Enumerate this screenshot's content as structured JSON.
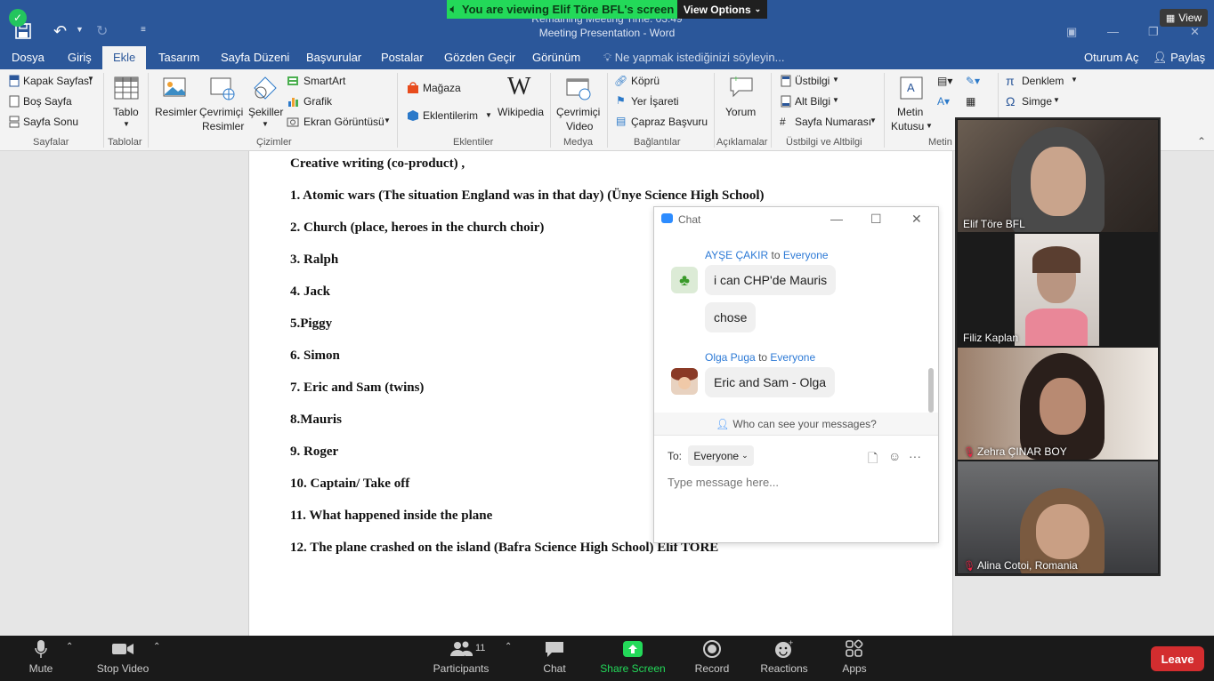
{
  "zoom": {
    "share_banner": "You are viewing Elif Töre BFL's screen",
    "view_options": "View Options",
    "view_button": "View"
  },
  "word": {
    "title_time": "Remaining Meeting Time: 03:49",
    "title": "Meeting Presentation - Word",
    "tabs": [
      "Dosya",
      "Giriş",
      "Ekle",
      "Tasarım",
      "Sayfa Düzeni",
      "Başvurular",
      "Postalar",
      "Gözden Geçir",
      "Görünüm"
    ],
    "active_tab": "Ekle",
    "tell_me": "Ne yapmak istediğinizi söyleyin...",
    "sign_in": "Oturum Aç",
    "share": "Paylaş"
  },
  "ribbon": {
    "sayfalar": {
      "items": [
        "Kapak Sayfası",
        "Boş Sayfa",
        "Sayfa Sonu"
      ],
      "caption": "Sayfalar"
    },
    "tablolar": {
      "tablo": "Tablo",
      "caption": "Tablolar"
    },
    "cizimler": {
      "resimler": "Resimler",
      "cevrimici_1": "Çevrimiçi",
      "cevrimici_2": "Resimler",
      "sekiller": "Şekiller",
      "smartart": "SmartArt",
      "grafik": "Grafik",
      "ekran": "Ekran Görüntüsü",
      "caption": "Çizimler"
    },
    "eklentiler": {
      "magaza": "Mağaza",
      "eklentilerim": "Eklentilerim",
      "wikipedia": "Wikipedia",
      "caption": "Eklentiler"
    },
    "medya": {
      "video_1": "Çevrimiçi",
      "video_2": "Video",
      "caption": "Medya"
    },
    "baglantilar": {
      "kopru": "Köprü",
      "yer_isareti": "Yer İşareti",
      "capraz": "Çapraz Başvuru",
      "caption": "Bağlantılar"
    },
    "aciklamalar": {
      "yorum": "Yorum",
      "caption": "Açıklamalar"
    },
    "ustbilgi": {
      "ustbilgi": "Üstbilgi",
      "altbilgi": "Alt Bilgi",
      "sayfa_no": "Sayfa Numarası",
      "caption": "Üstbilgi ve Altbilgi"
    },
    "metin": {
      "kutu_1": "Metin",
      "kutu_2": "Kutusu",
      "caption": "Metin"
    },
    "simgeler": {
      "denklem": "Denklem",
      "simge": "Simge"
    }
  },
  "document": {
    "lines": [
      "Creative writing (co-product) ,",
      "1. Atomic wars (The situation England was in that day) (Ünye Science High School)",
      "2. Church (place, heroes in the church choir)",
      "3. Ralph",
      "4. Jack",
      "5.Piggy",
      "6. Simon",
      "7. Eric and Sam (twins)",
      "8.Mauris",
      "9. Roger",
      "10. Captain/ Take off",
      "11. What happened inside the plane",
      "12. The plane crashed on the island (Bafra Science High School) Elif TORE"
    ]
  },
  "chat": {
    "title": "Chat",
    "messages": [
      {
        "sender": "AYŞE ÇAKIR",
        "to_word": "to",
        "to": "Everyone",
        "bubbles": [
          "i can CHP'de Mauris",
          "chose"
        ]
      },
      {
        "sender": "Olga Puga",
        "to_word": "to",
        "to": "Everyone",
        "bubbles": [
          "Eric and Sam  - Olga"
        ]
      }
    ],
    "who_can_see": "Who can see your messages?",
    "to_label": "To:",
    "to_value": "Everyone",
    "placeholder": "Type message here..."
  },
  "videos": [
    {
      "name": "Elif Töre BFL",
      "muted": false
    },
    {
      "name": "Filiz Kaplan",
      "muted": false
    },
    {
      "name": "Zehra ÇINAR BOY",
      "muted": true
    },
    {
      "name": "Alina Cotoi, Romania",
      "muted": true
    }
  ],
  "toolbar": {
    "mute": "Mute",
    "stop_video": "Stop Video",
    "participants": "Participants",
    "participants_count": "11",
    "chat": "Chat",
    "share_screen": "Share Screen",
    "record": "Record",
    "reactions": "Reactions",
    "apps": "Apps",
    "leave": "Leave"
  },
  "colors": {
    "word_blue": "#2b579a",
    "zoom_green": "#23d959",
    "zoom_blue": "#2d8cff",
    "leave_red": "#d32d2f"
  }
}
